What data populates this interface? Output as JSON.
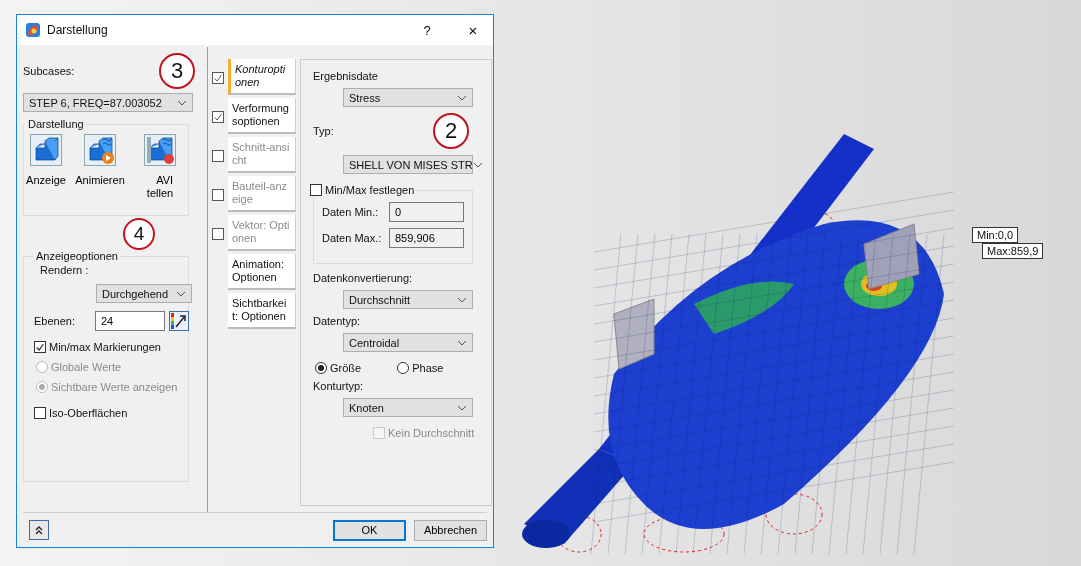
{
  "window": {
    "title": "Darstellung",
    "help": "?",
    "close": "×"
  },
  "subcases": {
    "label": "Subcases:",
    "value": "STEP 6, FREQ=87.003052"
  },
  "darstellung": {
    "title": "Darstellung",
    "buttons": [
      {
        "kind": "display",
        "lines": [
          "Anzeige"
        ]
      },
      {
        "kind": "animate",
        "lines": [
          "Animieren"
        ]
      },
      {
        "kind": "record",
        "lines": [
          "AVI",
          "tellen"
        ]
      }
    ]
  },
  "anzeigeoptionen": {
    "title": "Anzeigeoptionen",
    "render_label": "Rendern :",
    "render_value": "Durchgehend",
    "levels_label": "Ebenen:",
    "levels_value": "24",
    "minmax": {
      "label": "Min/max Markierungen",
      "checked": true
    },
    "radios": [
      {
        "label": "Globale Werte",
        "selected": false,
        "disabled": true
      },
      {
        "label": "Sichtbare Werte anzeigen",
        "selected": true,
        "disabled": true
      }
    ],
    "iso": {
      "label": "Iso-Oberflächen",
      "checked": false
    }
  },
  "tabs": [
    {
      "label": "Konturoptionen",
      "kind": "check",
      "checked": true,
      "selected": true,
      "disabled": false
    },
    {
      "label": "Verformungsoptionen",
      "kind": "check",
      "checked": true,
      "selected": false,
      "disabled": false
    },
    {
      "label": "Schnitt-ansicht",
      "kind": "check",
      "checked": false,
      "selected": false,
      "disabled": true
    },
    {
      "label": "Bauteil-anzeige",
      "kind": "check",
      "checked": false,
      "selected": false,
      "disabled": true
    },
    {
      "label": "Vektor: Optionen",
      "kind": "check",
      "checked": false,
      "selected": false,
      "disabled": true
    },
    {
      "label": "Animation: Optionen",
      "kind": "plain",
      "selected": false,
      "disabled": false
    },
    {
      "label": "Sichtbarkeit: Optionen",
      "kind": "plain",
      "selected": false,
      "disabled": false
    }
  ],
  "kontur": {
    "result_label": "Ergebnisdate",
    "result_value": "Stress",
    "type_label": "Typ:",
    "type_value": "SHELL VON MISES STR",
    "fix": {
      "label": "Min/Max festlegen",
      "checked": false,
      "min_label": "Daten Min.:",
      "min_value": "0",
      "max_label": "Daten Max.:",
      "max_value": "859,906"
    },
    "conv_label": "Datenkonvertierung:",
    "conv_value": "Durchschnitt",
    "dtype_label": "Datentyp:",
    "dtype_value": "Centroidal",
    "radios": [
      {
        "label": "Größe",
        "selected": true
      },
      {
        "label": "Phase",
        "selected": false
      }
    ],
    "ctype_label": "Konturtyp:",
    "ctype_value": "Knoten",
    "no_avg": {
      "label": "Kein Durchschnitt",
      "checked": false,
      "disabled": true
    }
  },
  "footer": {
    "ok": "OK",
    "cancel": "Abbrechen"
  },
  "viewport": {
    "min_marker": "Min:0,0",
    "max_marker": "Max:859,9"
  },
  "callouts": [
    "3",
    "4",
    "2"
  ]
}
